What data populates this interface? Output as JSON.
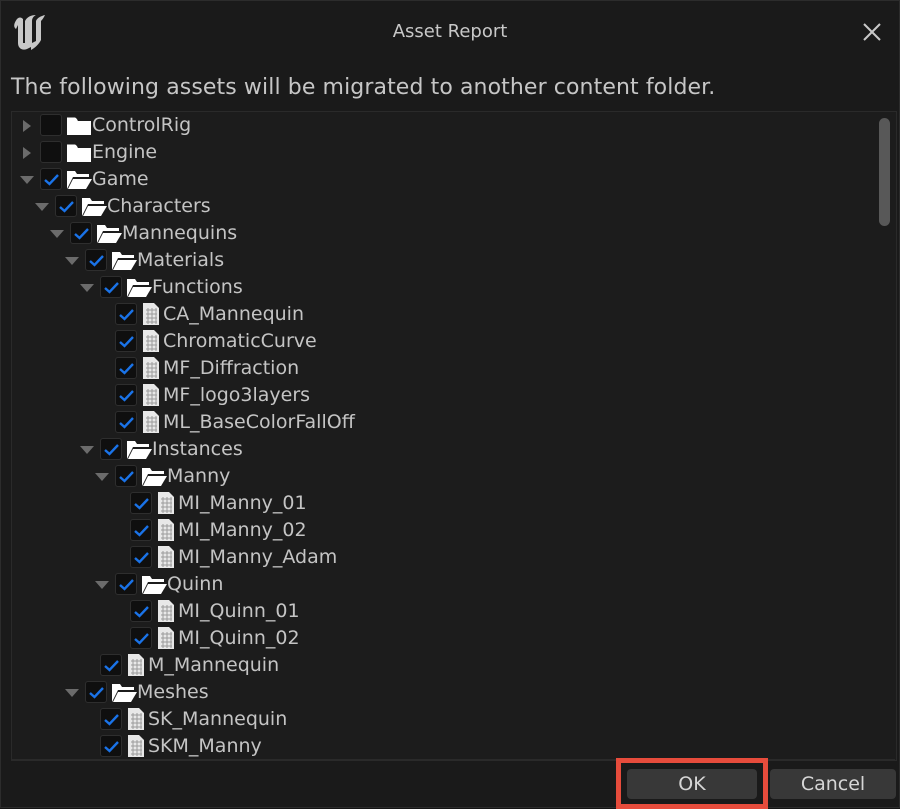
{
  "window": {
    "title": "Asset Report",
    "logo_icon": "unreal-engine-logo",
    "close_icon": "close-icon"
  },
  "description": "The following assets will be migrated to another content folder.",
  "tree": [
    {
      "label": "ControlRig",
      "depth": 0,
      "type": "folder",
      "state": "collapsed",
      "checked": false
    },
    {
      "label": "Engine",
      "depth": 0,
      "type": "folder",
      "state": "collapsed",
      "checked": false
    },
    {
      "label": "Game",
      "depth": 0,
      "type": "folder",
      "state": "expanded",
      "checked": true
    },
    {
      "label": "Characters",
      "depth": 1,
      "type": "folder",
      "state": "expanded",
      "checked": true
    },
    {
      "label": "Mannequins",
      "depth": 2,
      "type": "folder",
      "state": "expanded",
      "checked": true
    },
    {
      "label": "Materials",
      "depth": 3,
      "type": "folder",
      "state": "expanded",
      "checked": true
    },
    {
      "label": "Functions",
      "depth": 4,
      "type": "folder",
      "state": "expanded",
      "checked": true
    },
    {
      "label": "CA_Mannequin",
      "depth": 5,
      "type": "asset",
      "checked": true
    },
    {
      "label": "ChromaticCurve",
      "depth": 5,
      "type": "asset",
      "checked": true
    },
    {
      "label": "MF_Diffraction",
      "depth": 5,
      "type": "asset",
      "checked": true
    },
    {
      "label": "MF_logo3layers",
      "depth": 5,
      "type": "asset",
      "checked": true
    },
    {
      "label": "ML_BaseColorFallOff",
      "depth": 5,
      "type": "asset",
      "checked": true
    },
    {
      "label": "Instances",
      "depth": 4,
      "type": "folder",
      "state": "expanded",
      "checked": true
    },
    {
      "label": "Manny",
      "depth": 5,
      "type": "folder",
      "state": "expanded",
      "checked": true
    },
    {
      "label": "MI_Manny_01",
      "depth": 6,
      "type": "asset",
      "checked": true
    },
    {
      "label": "MI_Manny_02",
      "depth": 6,
      "type": "asset",
      "checked": true
    },
    {
      "label": "MI_Manny_Adam",
      "depth": 6,
      "type": "asset",
      "checked": true
    },
    {
      "label": "Quinn",
      "depth": 5,
      "type": "folder",
      "state": "expanded",
      "checked": true
    },
    {
      "label": "MI_Quinn_01",
      "depth": 6,
      "type": "asset",
      "checked": true
    },
    {
      "label": "MI_Quinn_02",
      "depth": 6,
      "type": "asset",
      "checked": true
    },
    {
      "label": "M_Mannequin",
      "depth": 4,
      "type": "asset",
      "checked": true
    },
    {
      "label": "Meshes",
      "depth": 3,
      "type": "folder",
      "state": "expanded",
      "checked": true
    },
    {
      "label": "SK_Mannequin",
      "depth": 4,
      "type": "asset",
      "checked": true
    },
    {
      "label": "SKM_Manny",
      "depth": 4,
      "type": "asset",
      "checked": true
    }
  ],
  "buttons": {
    "ok": "OK",
    "cancel": "Cancel"
  },
  "colors": {
    "check": "#1a73e8",
    "highlight": "#e74c3c"
  }
}
